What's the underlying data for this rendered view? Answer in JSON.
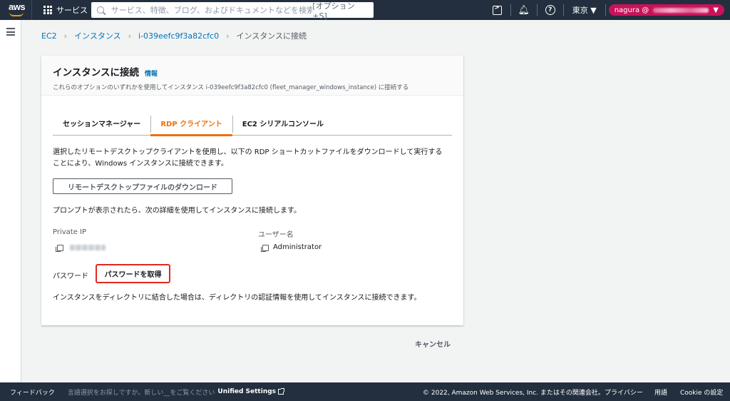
{
  "topnav": {
    "logo_text": "aws",
    "services_label": "サービス",
    "search_placeholder": "サービス、特徴、ブログ、およびドキュメントなどを検索",
    "search_hint": "[オプション+S]",
    "region": "東京 ▼",
    "account_prefix": "nagura @",
    "account_caret": "▼",
    "icons": [
      "cloudshell-icon",
      "bell-icon",
      "help-icon"
    ]
  },
  "breadcrumb": {
    "items": [
      "EC2",
      "インスタンス",
      "i-039eefc9f3a82cfc0"
    ],
    "current": "インスタンスに接続"
  },
  "card": {
    "title": "インスタンスに接続",
    "info": "情報",
    "description": "これらのオプションのいずれかを使用してインスタンス i-039eefc9f3a82cfc0 (fleet_manager_windows_instance) に接続する"
  },
  "tabs": [
    {
      "label": "セッションマネージャー"
    },
    {
      "label": "RDP クライアント",
      "active": true
    },
    {
      "label": "EC2 シリアルコンソール"
    }
  ],
  "rdp": {
    "intro_line1": "選択したリモートデスクトップクライアントを使用し、以下の RDP ショートカットファイルをダウンロードして実行する",
    "intro_line2": "ことにより、Windows インスタンスに接続できます。",
    "download_button": "リモートデスクトップファイルのダウンロード",
    "prompt_text": "プロンプトが表示されたら、次の詳細を使用してインスタンスに接続します。",
    "private_ip_label": "Private IP",
    "username_label": "ユーザー名",
    "username_value": "Administrator",
    "password_label": "パスワード",
    "get_password_button": "パスワードを取得",
    "directory_text": "インスタンスをディレクトリに結合した場合は、ディレクトリの認証情報を使用してインスタンスに接続できます。"
  },
  "cancel_button": "キャンセル",
  "footer": {
    "feedback": "フィードバック",
    "language_prompt": "言語選択をお探しですか。新しい__をご覧ください",
    "unified_settings": "Unified Settings",
    "copyright": "© 2022, Amazon Web Services, Inc. またはその関連会社。",
    "privacy": "プライバシー",
    "terms": "用語",
    "cookie": "Cookie の設定"
  },
  "colors": {
    "nav_bg": "#232f3e",
    "link": "#0073bb",
    "active_tab": "#ec7211",
    "account_badge": "#c7125a",
    "highlight_box": "#e0291f"
  }
}
